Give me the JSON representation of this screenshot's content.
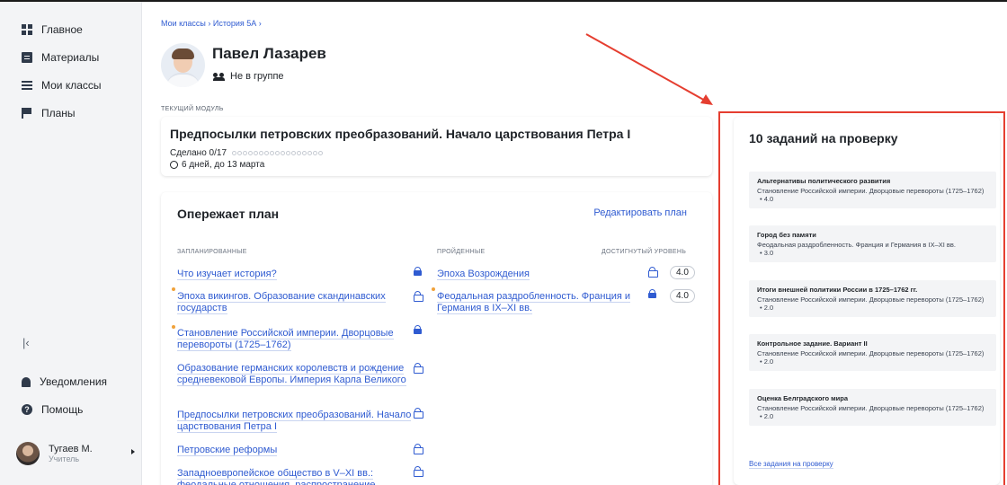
{
  "sidebar": {
    "items": [
      {
        "label": "Главное",
        "icon": "dashboard-icon"
      },
      {
        "label": "Материалы",
        "icon": "materials-icon"
      },
      {
        "label": "Мои классы",
        "icon": "classes-icon"
      },
      {
        "label": "Планы",
        "icon": "flag-icon"
      }
    ],
    "collapse_glyph": "|‹",
    "notifications": "Уведомления",
    "help": "Помощь",
    "user": {
      "name": "Тугаев М.",
      "role": "Учитель"
    }
  },
  "breadcrumb": "Мои классы › История 5А ›",
  "student": {
    "name": "Павел Лазарев",
    "group": "Не в группе"
  },
  "module": {
    "label": "ТЕКУЩИЙ МОДУЛЬ",
    "title": "Предпосылки петровских преобразований. Начало царствования Петра I",
    "progress": "Сделано 0/17",
    "progress_done": 0,
    "progress_total": 17,
    "deadline": "6 дней, до 13 марта"
  },
  "plan": {
    "title": "Опережает план",
    "edit": "Редактировать план",
    "col_planned": "ЗАПЛАНИРОВАННЫЕ",
    "col_done": "ПРОЙДЕННЫЕ",
    "col_level": "ДОСТИГНУТЫЙ УРОВЕНЬ",
    "planned": [
      {
        "title": "Что изучает история?",
        "marked": false,
        "lock": "locked"
      },
      {
        "title": "Эпоха викингов. Образование скандинавских государств",
        "marked": true,
        "lock": "open"
      },
      {
        "title": "Становление Российской империи. Дворцовые перевороты (1725–1762)",
        "marked": true,
        "lock": "locked"
      },
      {
        "title": "Образование германских королевств и рождение средневековой Европы. Империя Карла Великого",
        "marked": false,
        "lock": "open"
      },
      {
        "title": "Предпосылки петровских преобразований. Начало царствования Петра I",
        "marked": false,
        "lock": "open"
      },
      {
        "title": "Петровские реформы",
        "marked": false,
        "lock": "open"
      },
      {
        "title": "Западноевропейское общество в V–XI вв.: феодальные отношения, распространение",
        "marked": false,
        "lock": "open"
      }
    ],
    "done": [
      {
        "title": "Эпоха Возрождения",
        "marked": false,
        "lock": "open",
        "level": "4.0"
      },
      {
        "title": "Феодальная раздробленность. Франция и Германия в IX–XI вв.",
        "marked": true,
        "lock": "locked",
        "level": "4.0"
      }
    ]
  },
  "review": {
    "title": "10 заданий на проверку",
    "tasks": [
      {
        "title": "Альтернативы политического развития",
        "subject": "Становление Российской империи. Дворцовые перевороты (1725–1762)",
        "score": "• 4.0"
      },
      {
        "title": "Город без памяти",
        "subject": "Феодальная раздробленность. Франция и Германия в IX–XI вв.",
        "score": "• 3.0"
      },
      {
        "title": "Итоги внешней политики России в 1725–1762 гг.",
        "subject": "Становление Российской империи. Дворцовые перевороты (1725–1762)",
        "score": "• 2.0"
      },
      {
        "title": "Контрольное задание. Вариант II",
        "subject": "Становление Российской империи. Дворцовые перевороты (1725–1762)",
        "score": "• 2.0"
      },
      {
        "title": "Оценка Белградского мира",
        "subject": "Становление Российской империи. Дворцовые перевороты (1725–1762)",
        "score": "• 2.0"
      }
    ],
    "all_link": "Все задания на проверку"
  },
  "colors": {
    "accent": "#2f5bd1",
    "annotation": "#e53e30",
    "marker": "#f0a23a"
  }
}
